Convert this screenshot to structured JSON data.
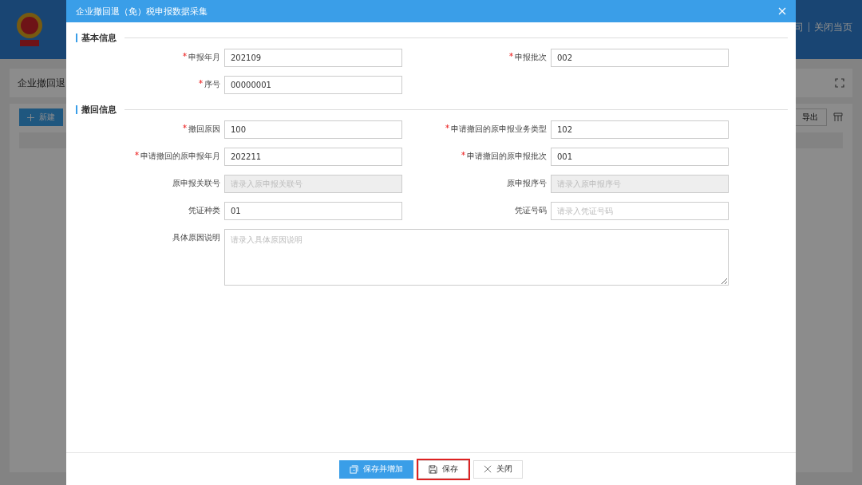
{
  "background": {
    "header_links": [
      "司",
      "关闭当页"
    ],
    "page_title": "企业撤回退",
    "toolbar": {
      "new_button": "新建",
      "export_button": "导出"
    }
  },
  "modal": {
    "title": "企业撤回退（免）税申报数据采集",
    "sections": [
      {
        "title": "基本信息",
        "fields": [
          {
            "kind": "input",
            "label": "申报年月",
            "required": true,
            "value": "202109",
            "disabled": false
          },
          {
            "kind": "input",
            "label": "申报批次",
            "required": true,
            "value": "002",
            "disabled": false
          },
          {
            "kind": "input",
            "label": "序号",
            "required": true,
            "value": "00000001",
            "disabled": false
          }
        ]
      },
      {
        "title": "撤回信息",
        "fields": [
          {
            "kind": "input",
            "label": "撤回原因",
            "required": true,
            "value": "100",
            "disabled": false
          },
          {
            "kind": "input",
            "label": "申请撤回的原申报业务类型",
            "required": true,
            "value": "102",
            "disabled": false
          },
          {
            "kind": "input",
            "label": "申请撤回的原申报年月",
            "required": true,
            "value": "202211",
            "disabled": false
          },
          {
            "kind": "input",
            "label": "申请撤回的原申报批次",
            "required": true,
            "value": "001",
            "disabled": false
          },
          {
            "kind": "input",
            "label": "原申报关联号",
            "required": false,
            "placeholder": "请录入原申报关联号",
            "disabled": true
          },
          {
            "kind": "input",
            "label": "原申报序号",
            "required": false,
            "placeholder": "请录入原申报序号",
            "disabled": true
          },
          {
            "kind": "input",
            "label": "凭证种类",
            "required": false,
            "value": "01",
            "disabled": false
          },
          {
            "kind": "input",
            "label": "凭证号码",
            "required": false,
            "placeholder": "请录入凭证号码",
            "disabled": false
          },
          {
            "kind": "textarea",
            "label": "具体原因说明",
            "required": false,
            "placeholder": "请录入具体原因说明",
            "disabled": false
          }
        ]
      }
    ],
    "buttons": [
      {
        "kind": "primary",
        "label": "保存并增加",
        "highlighted": false
      },
      {
        "kind": "save",
        "label": "保存",
        "highlighted": true
      },
      {
        "kind": "close",
        "label": "关闭",
        "highlighted": false
      }
    ]
  }
}
